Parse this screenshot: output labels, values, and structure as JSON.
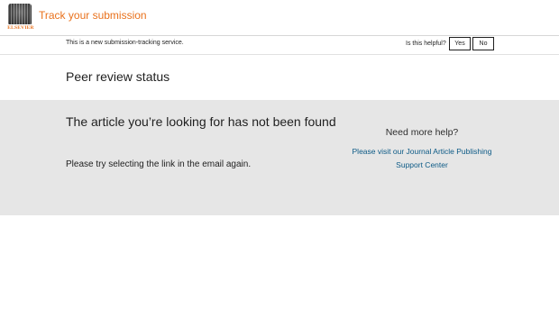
{
  "header": {
    "logo_text": "ELSEVIER",
    "title": "Track your submission"
  },
  "notice": {
    "text": "This is a new submission-tracking service.",
    "helpful_label": "Is this helpful?",
    "yes_label": "Yes",
    "no_label": "No"
  },
  "page": {
    "title": "Peer review status"
  },
  "error": {
    "heading": "The article you’re looking for has not been found",
    "subtext": "Please try selecting the link in the email again."
  },
  "help": {
    "heading": "Need more help?",
    "link_text": "Please visit our Journal Article Publishing Support Center"
  },
  "colors": {
    "brand_orange": "#e9711c",
    "link_blue": "#0c5a86",
    "panel_gray": "#e6e6e6"
  }
}
